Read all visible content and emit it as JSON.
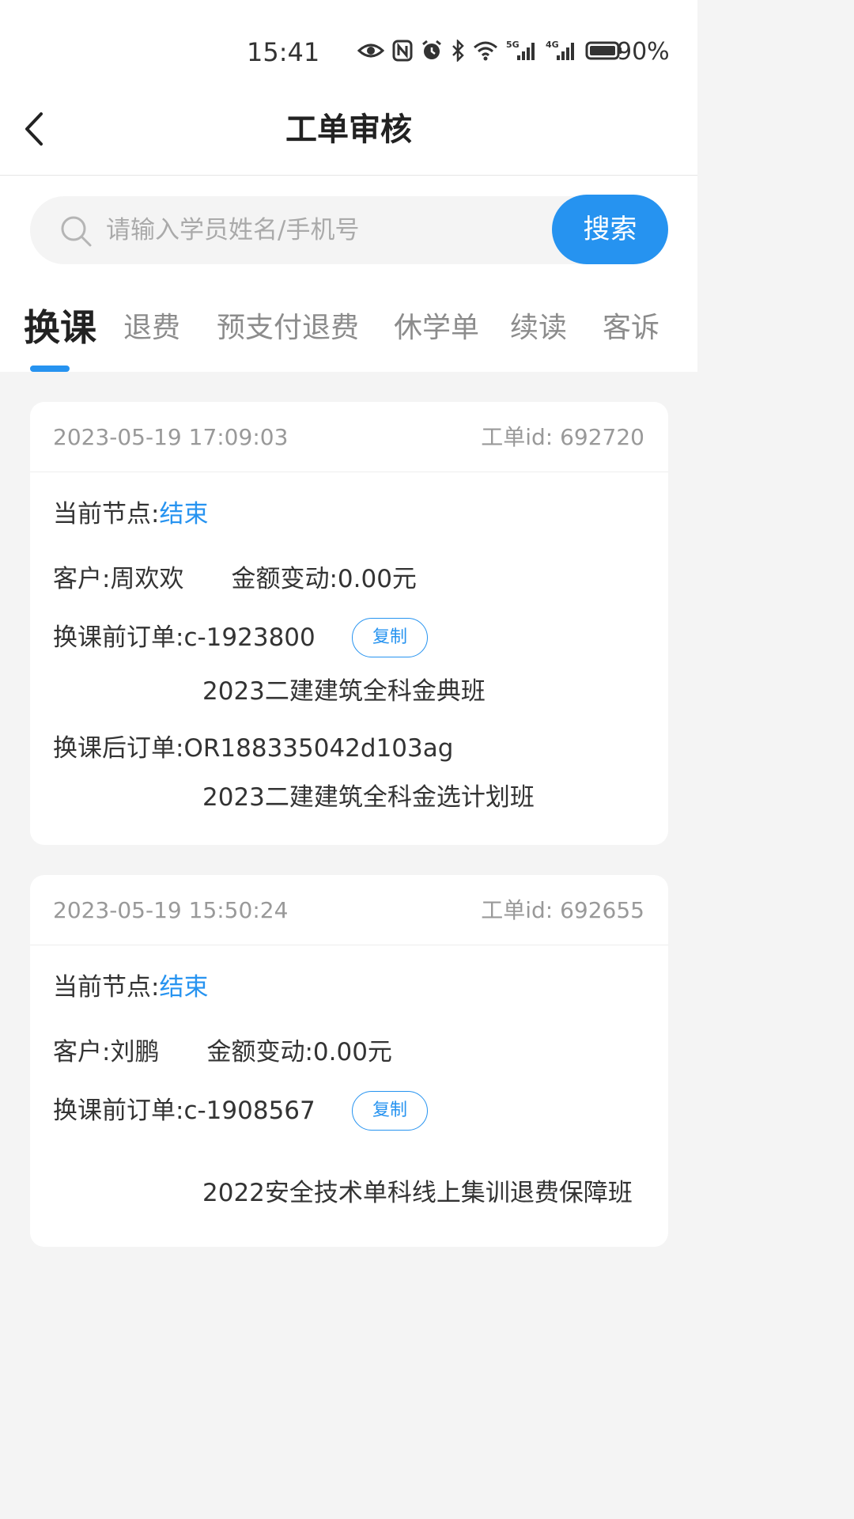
{
  "status_bar": {
    "time": "15:41",
    "battery": "90%",
    "icons": [
      "eye-icon",
      "nfc-icon",
      "alarm-icon",
      "bluetooth-icon",
      "wifi-icon",
      "signal-5g-icon",
      "signal-4g-icon",
      "battery-icon"
    ],
    "badge_5g": "5G",
    "badge_4g": "4G"
  },
  "header": {
    "title": "工单审核"
  },
  "search": {
    "placeholder": "请输入学员姓名/手机号",
    "value": "",
    "button_label": "搜索"
  },
  "tabs": [
    {
      "label": "换课",
      "active": true
    },
    {
      "label": "退费",
      "active": false
    },
    {
      "label": "预支付退费",
      "active": false
    },
    {
      "label": "休学单",
      "active": false
    },
    {
      "label": "续读",
      "active": false
    },
    {
      "label": "客诉",
      "active": false
    }
  ],
  "colors": {
    "accent": "#2693f0",
    "page_bg": "#f4f4f4",
    "text": "#333333",
    "muted": "#999999"
  },
  "orders": [
    {
      "time": "2023-05-19 17:09:03",
      "id_label": "工单id:",
      "id": "692720",
      "node_label": "当前节点:",
      "node_value": "结束",
      "customer_label": "客户:",
      "customer": "周欢欢",
      "amount_label": "金额变动:",
      "amount": "0.00元",
      "before_label": "换课前订单:",
      "before_order": "c-1923800",
      "copy_label": "复制",
      "before_course": "2023二建建筑全科金典班",
      "after_label": "换课后订单:",
      "after_order": "OR188335042d103ag",
      "after_course": "2023二建建筑全科金选计划班"
    },
    {
      "time": "2023-05-19 15:50:24",
      "id_label": "工单id:",
      "id": "692655",
      "node_label": "当前节点:",
      "node_value": "结束",
      "customer_label": "客户:",
      "customer": "刘鹏",
      "amount_label": "金额变动:",
      "amount": "0.00元",
      "before_label": "换课前订单:",
      "before_order": "c-1908567",
      "copy_label": "复制",
      "before_course": "2022安全技术单科线上集训退费保障班"
    }
  ]
}
